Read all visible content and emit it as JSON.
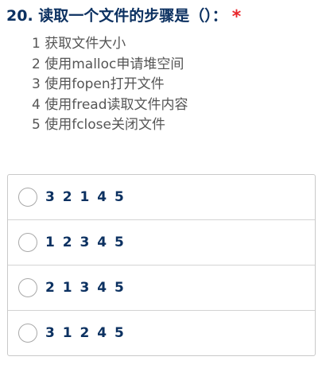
{
  "question": {
    "title": "20. 读取一个文件的步骤是（）：",
    "required_mark": "*"
  },
  "steps": [
    "1 获取文件大小",
    "2 使用malloc申请堆空间",
    "3 使用fopen打开文件",
    "4 使用fread读取文件内容",
    "5 使用fclose关闭文件"
  ],
  "options": [
    "3 2 1 4 5",
    "1 2 3 4 5",
    "2 1 3 4 5",
    "3 1 2 4 5"
  ],
  "colors": {
    "title": "#0c3161",
    "required": "#e8262b",
    "step_text": "#555555",
    "border": "#c9c9c9"
  }
}
